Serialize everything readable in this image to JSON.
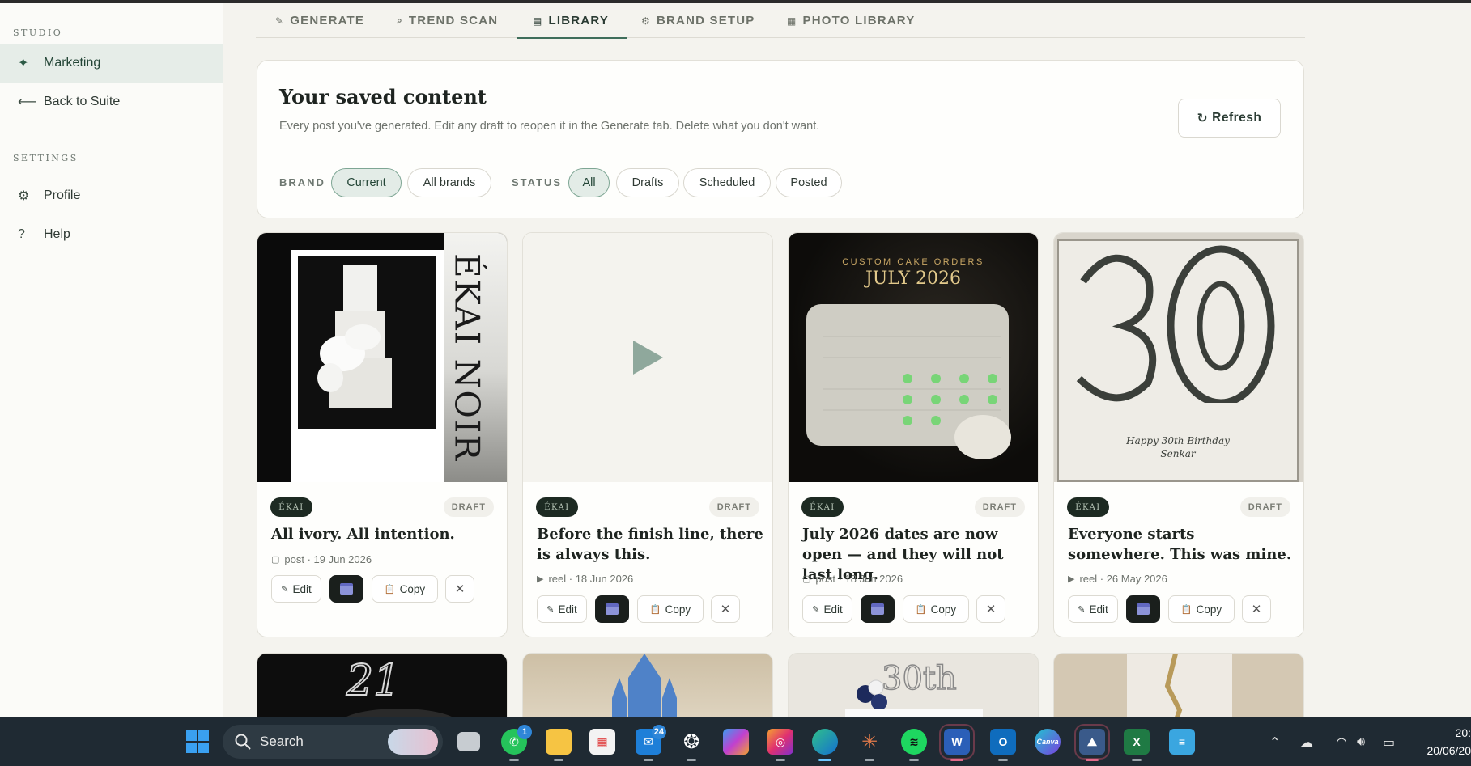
{
  "sidebar": {
    "section_studio": "STUDIO",
    "section_settings": "SETTINGS",
    "items": [
      {
        "icon": "sparkle-icon",
        "glyph": "✦",
        "label": "Marketing"
      },
      {
        "icon": "arrow-left-icon",
        "glyph": "⟵",
        "label": "Back to Suite"
      },
      {
        "icon": "gear-icon",
        "glyph": "⚙",
        "label": "Profile"
      },
      {
        "icon": "help-icon",
        "glyph": "?",
        "label": "Help"
      }
    ]
  },
  "tabs": [
    {
      "glyph": "✎",
      "label": "GENERATE"
    },
    {
      "glyph": "⌕",
      "label": "TREND SCAN"
    },
    {
      "glyph": "▤",
      "label": "LIBRARY"
    },
    {
      "glyph": "⚙",
      "label": "BRAND SETUP"
    },
    {
      "glyph": "▦",
      "label": "PHOTO LIBRARY"
    }
  ],
  "header": {
    "title": "Your saved content",
    "description": "Every post you've generated. Edit any draft to reopen it in the Generate tab. Delete what you don't want.",
    "refresh_label": "Refresh",
    "refresh_glyph": "↻",
    "brand_label": "BRAND",
    "brand_chips": [
      "Current",
      "All brands"
    ],
    "status_label": "STATUS",
    "status_chips": [
      "All",
      "Drafts",
      "Scheduled",
      "Posted"
    ]
  },
  "cards": [
    {
      "brand": "ÉKAI",
      "status": "DRAFT",
      "title": "All ivory. All intention.",
      "type_glyph": "▢",
      "meta": "post · 19 Jun 2026",
      "thumb_text": "ÉKAI NOIR"
    },
    {
      "brand": "ÉKAI",
      "status": "DRAFT",
      "title": "Before the finish line, there is always this.",
      "type_glyph": "▶",
      "meta": "reel · 18 Jun 2026",
      "thumb_text": ""
    },
    {
      "brand": "ÉKAI",
      "status": "DRAFT",
      "title": "July 2026 dates are now open — and they will not last long.",
      "type_glyph": "▢",
      "meta": "post · 18 Jun 2026",
      "thumb_text": "CUSTOM CAKE ORDERS",
      "thumb_text2": "JULY 2026"
    },
    {
      "brand": "ÉKAI",
      "status": "DRAFT",
      "title": "Everyone starts somewhere. This was mine.",
      "type_glyph": "▶",
      "meta": "reel · 26 May 2026",
      "thumb_text": "Happy 30th Birthday",
      "thumb_text2": "Senkar"
    }
  ],
  "card_actions": {
    "edit": "Edit",
    "edit_glyph": "✎",
    "copy": "Copy",
    "copy_glyph": "📋",
    "delete_glyph": "✕"
  },
  "bottom_row": {
    "thumb1_text": "21",
    "thumb3_text": "30th"
  },
  "taskbar": {
    "search_placeholder": "Search",
    "whatsapp_badge": "1",
    "outlook_badge": "24",
    "canva_label": "Canva",
    "time": "20:",
    "date": "20/06/20"
  },
  "colors": {
    "accent": "#3f6e5b",
    "active_bg": "#e6ede8",
    "badge_dark": "#1d2a22"
  }
}
